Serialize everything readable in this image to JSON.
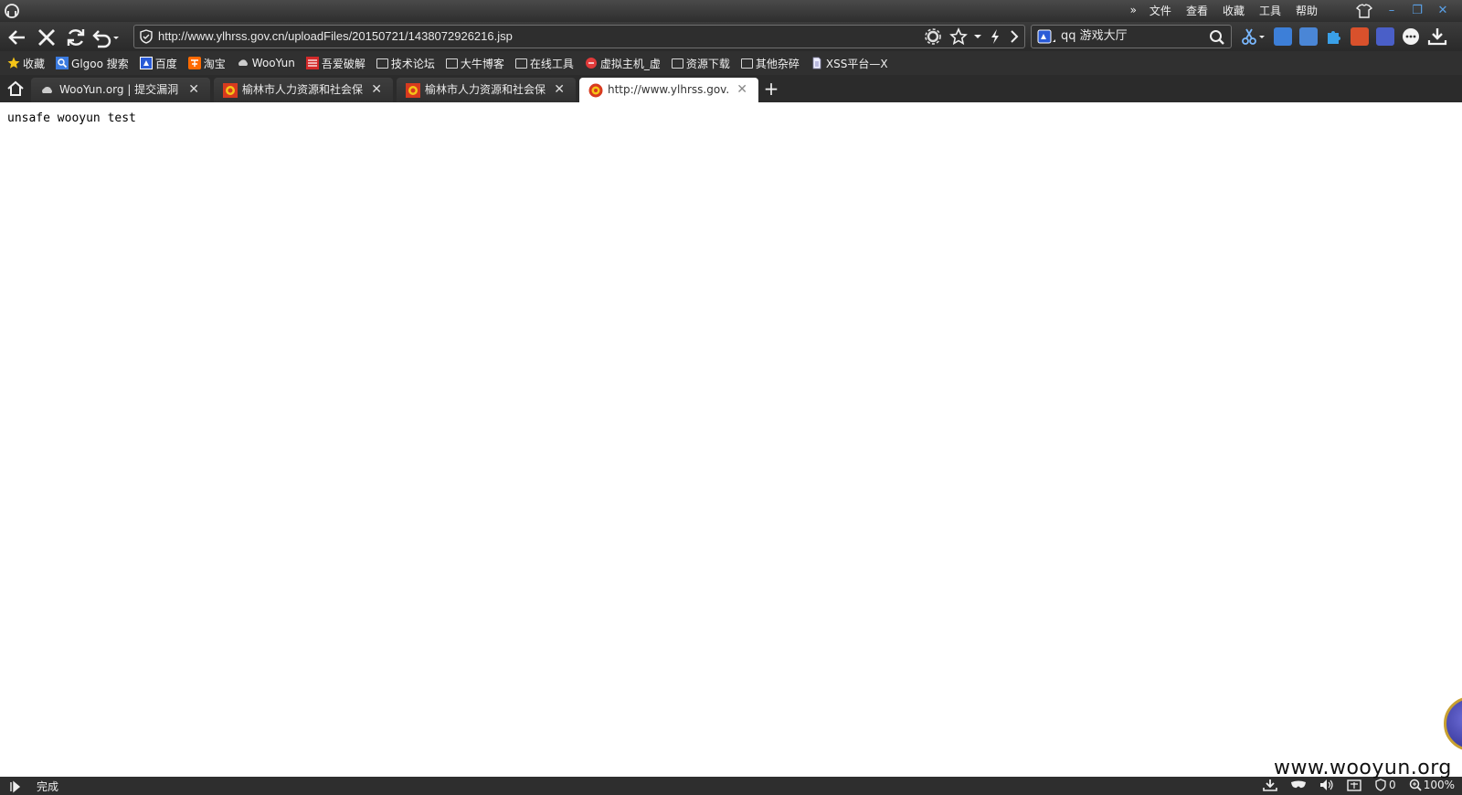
{
  "titlebar": {
    "menu": [
      "文件",
      "查看",
      "收藏",
      "工具",
      "帮助"
    ],
    "more": "»",
    "min": "–",
    "max": "❐",
    "close": "✕"
  },
  "nav": {
    "url": "http://www.ylhrss.gov.cn/uploadFiles/20150721/1438072926216.jsp",
    "search_value": "qq 游戏大厅"
  },
  "bookmarks": [
    {
      "label": "收藏",
      "icon": "star-icon"
    },
    {
      "label": "Glgoo 搜索",
      "icon": "search-icon"
    },
    {
      "label": "百度",
      "icon": "baidu-icon"
    },
    {
      "label": "淘宝",
      "icon": "taobao-icon"
    },
    {
      "label": "WooYun",
      "icon": "cloud-icon"
    },
    {
      "label": "吾爱破解",
      "icon": "site-icon"
    },
    {
      "label": "技术论坛",
      "icon": "folder-icon"
    },
    {
      "label": "大牛博客",
      "icon": "folder-icon"
    },
    {
      "label": "在线工具",
      "icon": "folder-icon"
    },
    {
      "label": "虚拟主机_虚",
      "icon": "site-icon"
    },
    {
      "label": "资源下载",
      "icon": "folder-icon"
    },
    {
      "label": "其他杂碎",
      "icon": "folder-icon"
    },
    {
      "label": "XSS平台—X",
      "icon": "page-icon"
    }
  ],
  "tabs": [
    {
      "title": "WooYun.org | 提交漏洞",
      "active": false
    },
    {
      "title": "榆林市人力资源和社会保",
      "active": false
    },
    {
      "title": "榆林市人力资源和社会保",
      "active": false
    },
    {
      "title": "http://www.ylhrss.gov.cn",
      "active": true
    }
  ],
  "tab_close": "✕",
  "new_tab": "+",
  "content": {
    "text": "unsafe wooyun test"
  },
  "status": {
    "text": "完成",
    "block_count": "0",
    "zoom": "100%"
  },
  "watermark": "www.wooyun.org",
  "colors": {
    "chrome_dark": "#2e2e2e",
    "accent": "#5aa0e6"
  }
}
